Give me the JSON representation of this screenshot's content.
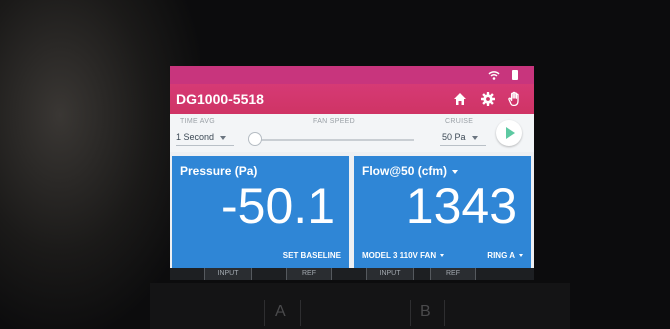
{
  "device": {
    "title": "DG1000-5518"
  },
  "controls": {
    "time_avg_label": "TIME AVG",
    "time_avg_value": "1 Second",
    "fan_speed_label": "FAN SPEED",
    "fan_speed_level": 0,
    "cruise_label": "CRUISE",
    "cruise_value": "50 Pa"
  },
  "channel_a": {
    "title": "Pressure (Pa)",
    "value": "-50.1",
    "action_label": "SET BASELINE"
  },
  "channel_b": {
    "title": "Flow@50 (cfm)",
    "value": "1343",
    "device_label": "MODEL 3 110V FAN",
    "ring_label": "RING A"
  },
  "tabs": [
    "INPUT",
    "REF",
    "INPUT",
    "REF"
  ],
  "ports": [
    "A",
    "B"
  ],
  "icons": {
    "status": [
      "wifi-icon",
      "battery-icon"
    ],
    "appbar": [
      "home-icon",
      "gear-icon",
      "hand-icon"
    ],
    "action": "play-icon"
  },
  "colors": {
    "appbar": "#cf3465",
    "panel": "#2f86d6",
    "play": "#5dc9a2"
  }
}
